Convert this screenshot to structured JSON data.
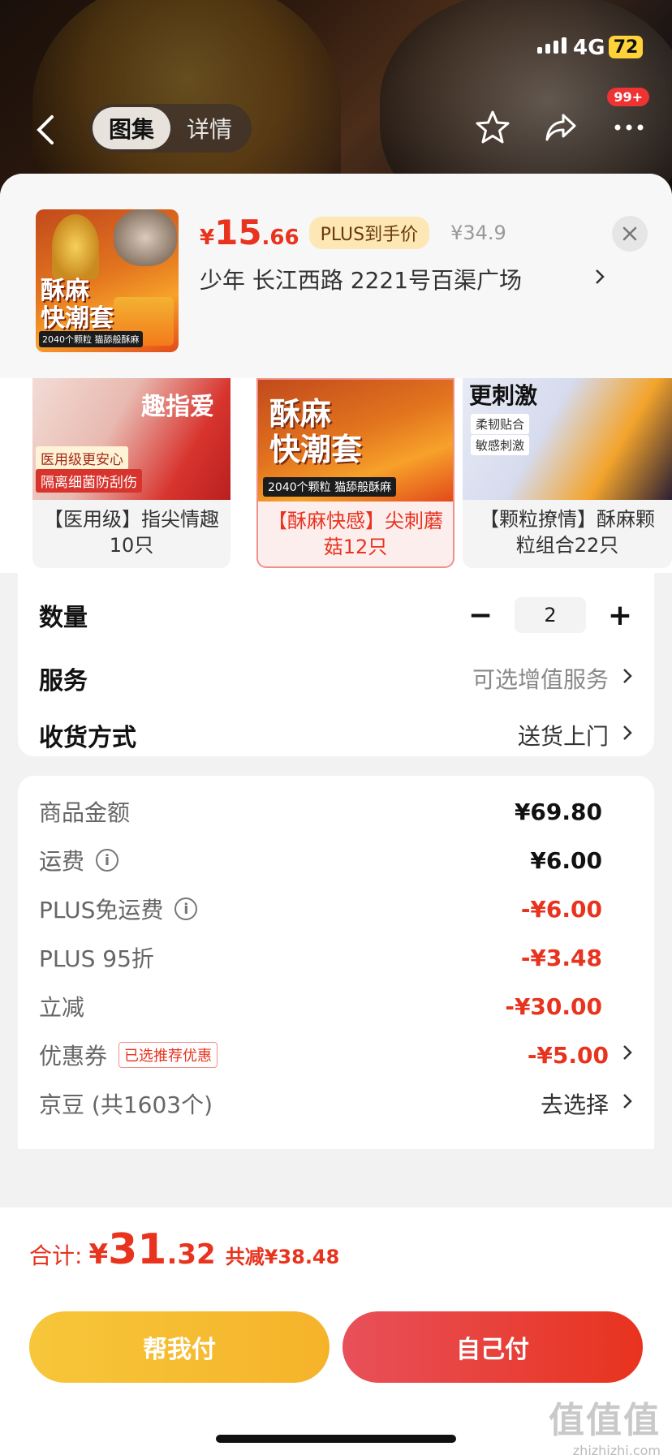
{
  "status_bar": {
    "time": "",
    "network": "4G",
    "battery": "72"
  },
  "nav": {
    "tabs": [
      {
        "label": "图集",
        "active": true
      },
      {
        "label": "详情",
        "active": false
      }
    ],
    "badge": "99+",
    "icons": [
      "back-icon",
      "star-icon",
      "share-icon",
      "more-icon"
    ]
  },
  "sheet": {
    "price": {
      "currency": "¥",
      "integer": "15",
      "decimal": ".66"
    },
    "plus_tag": "PLUS到手价",
    "original_price": "¥34.9",
    "address": "少年  长江西路 2221号百渠广场",
    "close_label": "×"
  },
  "thumb": {
    "title_line1": "酥麻",
    "title_line2": "快潮套",
    "strip": "2040个颗粒  猫舔般酥麻"
  },
  "skus": [
    {
      "label": "【医用级】指尖情趣10只",
      "tag1": "医用级更安心",
      "tag2": "隔离细菌防刮伤",
      "art": "趣指爱",
      "selected": false
    },
    {
      "label": "【酥麻快感】尖刺蘑菇12只",
      "art1": "酥麻",
      "art2": "快潮套",
      "strip": "2040个颗粒  猫舔般酥麻",
      "selected": true
    },
    {
      "label": "【颗粒撩情】酥麻颗粒组合22只",
      "art": "更刺激",
      "tag1": "柔韧贴合",
      "tag2": "敏感刺激",
      "selected": false
    }
  ],
  "options": {
    "quantity": {
      "label": "数量",
      "value": "2",
      "minus": "−",
      "plus": "+"
    },
    "service": {
      "label": "服务",
      "value": "可选增值服务"
    },
    "delivery": {
      "label": "收货方式",
      "value": "送货上门"
    }
  },
  "breakdown": [
    {
      "label": "商品金额",
      "value": "¥69.80",
      "style": "normal"
    },
    {
      "label": "运费",
      "value": "¥6.00",
      "style": "normal",
      "info": true
    },
    {
      "label": "PLUS免运费",
      "value": "-¥6.00",
      "style": "red",
      "info": true
    },
    {
      "label": "PLUS 95折",
      "value": "-¥3.48",
      "style": "red"
    },
    {
      "label": "立减",
      "value": "-¥30.00",
      "style": "red"
    },
    {
      "label": "优惠券",
      "tag": "已选推荐优惠",
      "value": "-¥5.00",
      "style": "red",
      "chevron": true
    },
    {
      "label": "京豆 (共1603个)",
      "value": "去选择",
      "style": "plain",
      "chevron": true
    }
  ],
  "footer": {
    "total_label": "合计:",
    "total_currency": "¥",
    "total_integer": "31",
    "total_decimal": ".32",
    "total_saved": "共减¥38.48",
    "help_pay": "帮我付",
    "self_pay": "自己付",
    "watermark": "值值值",
    "watermark_url": "zhizhizhi.com"
  },
  "colors": {
    "accent_red": "#e8331e",
    "gold": "#f5b32a",
    "plus_tag_bg": "#fde7b5"
  }
}
